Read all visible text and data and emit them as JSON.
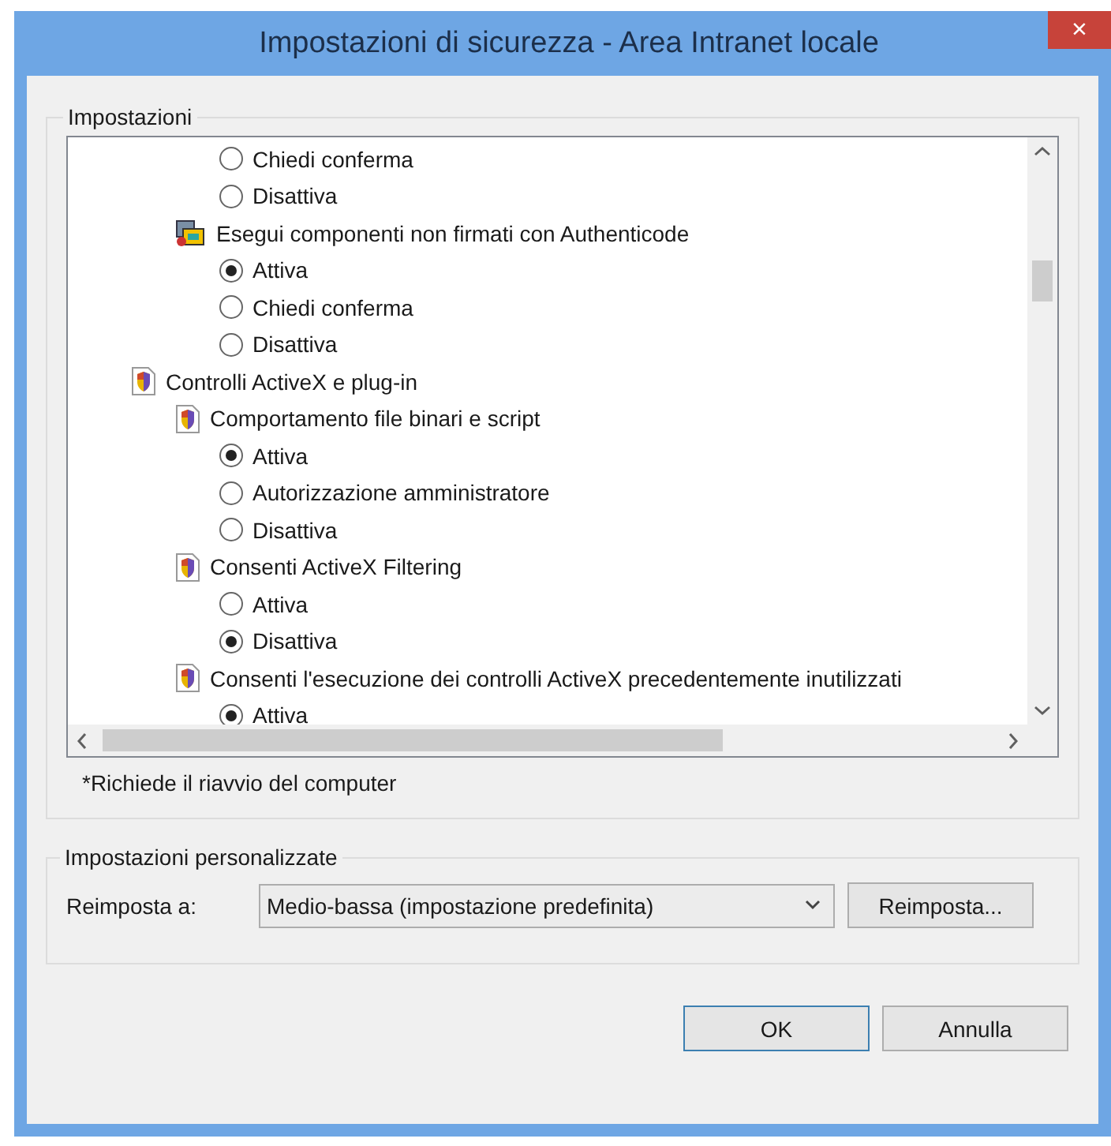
{
  "window": {
    "title": "Impostazioni di sicurezza - Area Intranet locale",
    "close": "×"
  },
  "settings_group": {
    "legend": "Impostazioni",
    "tree": [
      {
        "kind": "group",
        "children": [
          {
            "kind": "group",
            "children": [
              {
                "kind": "option",
                "label": "Chiedi conferma",
                "selected": false
              },
              {
                "kind": "option",
                "label": "Disattiva",
                "selected": false
              }
            ]
          },
          {
            "kind": "component",
            "label": "Esegui componenti non firmati con Authenticode",
            "children": [
              {
                "kind": "option",
                "label": "Attiva",
                "selected": true
              },
              {
                "kind": "option",
                "label": "Chiedi conferma",
                "selected": false
              },
              {
                "kind": "option",
                "label": "Disattiva",
                "selected": false
              }
            ]
          }
        ]
      },
      {
        "kind": "setting",
        "label": "Controlli ActiveX e plug-in",
        "children": [
          {
            "kind": "setting",
            "label": "Comportamento file binari e script",
            "children": [
              {
                "kind": "option",
                "label": "Attiva",
                "selected": true
              },
              {
                "kind": "option",
                "label": "Autorizzazione amministratore",
                "selected": false
              },
              {
                "kind": "option",
                "label": "Disattiva",
                "selected": false
              }
            ]
          },
          {
            "kind": "setting",
            "label": "Consenti ActiveX Filtering",
            "children": [
              {
                "kind": "option",
                "label": "Attiva",
                "selected": false
              },
              {
                "kind": "option",
                "label": "Disattiva",
                "selected": true
              }
            ]
          },
          {
            "kind": "setting",
            "label": "Consenti l'esecuzione dei controlli ActiveX precedentemente inutilizzati",
            "children": [
              {
                "kind": "option",
                "label": "Attiva",
                "selected": true
              }
            ]
          }
        ]
      }
    ],
    "note": "*Richiede il riavvio del computer"
  },
  "custom_group": {
    "legend": "Impostazioni personalizzate",
    "reset_label": "Reimposta a:",
    "reset_value": "Medio-bassa (impostazione predefinita)",
    "reset_button": "Reimposta..."
  },
  "buttons": [
    {
      "label": "OK",
      "default": true
    },
    {
      "label": "Annulla",
      "default": false
    }
  ]
}
